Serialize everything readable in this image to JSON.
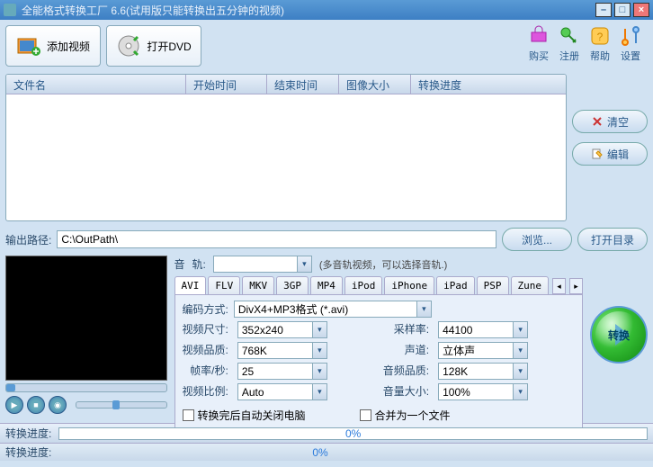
{
  "title": "全能格式转换工厂 6.6(试用版只能转换出五分钟的视频)",
  "toolbar": {
    "add_video": "添加视频",
    "open_dvd": "打开DVD"
  },
  "rightTools": {
    "buy": "购买",
    "register": "注册",
    "help": "帮助",
    "settings": "设置"
  },
  "columns": {
    "name": "文件名",
    "start": "开始时间",
    "end": "结束时间",
    "size": "图像大小",
    "progress": "转换进度"
  },
  "sideButtons": {
    "clear": "清空",
    "edit": "编辑"
  },
  "path": {
    "label": "输出路径:",
    "value": "C:\\OutPath\\",
    "browse": "浏览...",
    "open": "打开目录"
  },
  "track": {
    "label1": "音",
    "label2": "轨:",
    "hint": "(多音轨视频，可以选择音轨.)"
  },
  "tabs": [
    "AVI",
    "FLV",
    "MKV",
    "3GP",
    "MP4",
    "iPod",
    "iPhone",
    "iPad",
    "PSP",
    "Zune"
  ],
  "params": {
    "encoding_label": "编码方式:",
    "encoding": "DivX4+MP3格式 (*.avi)",
    "vsize_label": "视频尺寸:",
    "vsize": "352x240",
    "srate_label": "采样率:",
    "srate": "44100",
    "vqual_label": "视频品质:",
    "vqual": "768K",
    "chan_label": "声道:",
    "chan": "立体声",
    "fps_label": "帧率/秒:",
    "fps": "25",
    "aqual_label": "音频品质:",
    "aqual": "128K",
    "ratio_label": "视频比例:",
    "ratio": "Auto",
    "vol_label": "音量大小:",
    "vol": "100%",
    "chk_shutdown": "转换完后自动关闭电脑",
    "chk_merge": "合并为一个文件"
  },
  "convert": "转换",
  "status": {
    "label": "转换进度:",
    "pct": "0%"
  }
}
